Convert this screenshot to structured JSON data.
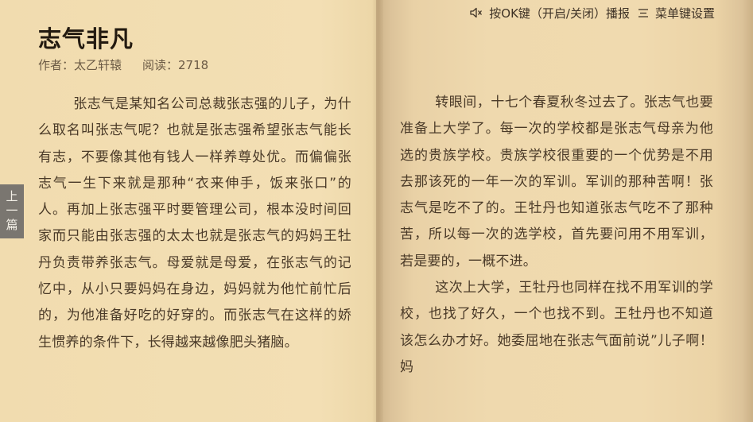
{
  "book": {
    "title": "志气非凡",
    "author": "作者：太乙轩辕",
    "reads": "阅读：2718"
  },
  "nav": {
    "prev_label": "上一篇"
  },
  "topbar": {
    "play_hint": "按OK键（开启/关闭）播报",
    "menu_hint": "菜单键设置",
    "icons": [
      "speaker-muted-icon",
      "menu-lines-icon"
    ]
  },
  "content": {
    "left_paragraphs": [
      "张志气是某知名公司总裁张志强的儿子，为什么取名叫张志气呢？也就是张志强希望张志气能长有志，不要像其他有钱人一样养尊处优。而偏偏张志气一生下来就是那种“衣来伸手，饭来张口”的人。再加上张志强平时要管理公司，根本没时间回家而只能由张志强的太太也就是张志气的妈妈王牡丹负责带养张志气。母爱就是母爱，在张志气的记忆中，从小只要妈妈在身边，妈妈就为他忙前忙后的，为他准备好吃的好穿的。而张志气在这样的娇生惯养的条件下，长得越来越像肥头猪脑。"
    ],
    "right_paragraphs": [
      "转眼间，十七个春夏秋冬过去了。张志气也要准备上大学了。每一次的学校都是张志气母亲为他选的贵族学校。贵族学校很重要的一个优势是不用去那该死的一年一次的军训。军训的那种苦啊！张志气是吃不了的。王牡丹也知道张志气吃不了那种苦，所以每一次的选学校，首先要问用不用军训，若是要的，一概不进。",
      "这次上大学，王牡丹也同样在找不用军训的学校，也找了好久，一个也找不到。王牡丹也不知道该怎么办才好。她委屈地在张志气面前说”儿子啊！妈"
    ]
  }
}
